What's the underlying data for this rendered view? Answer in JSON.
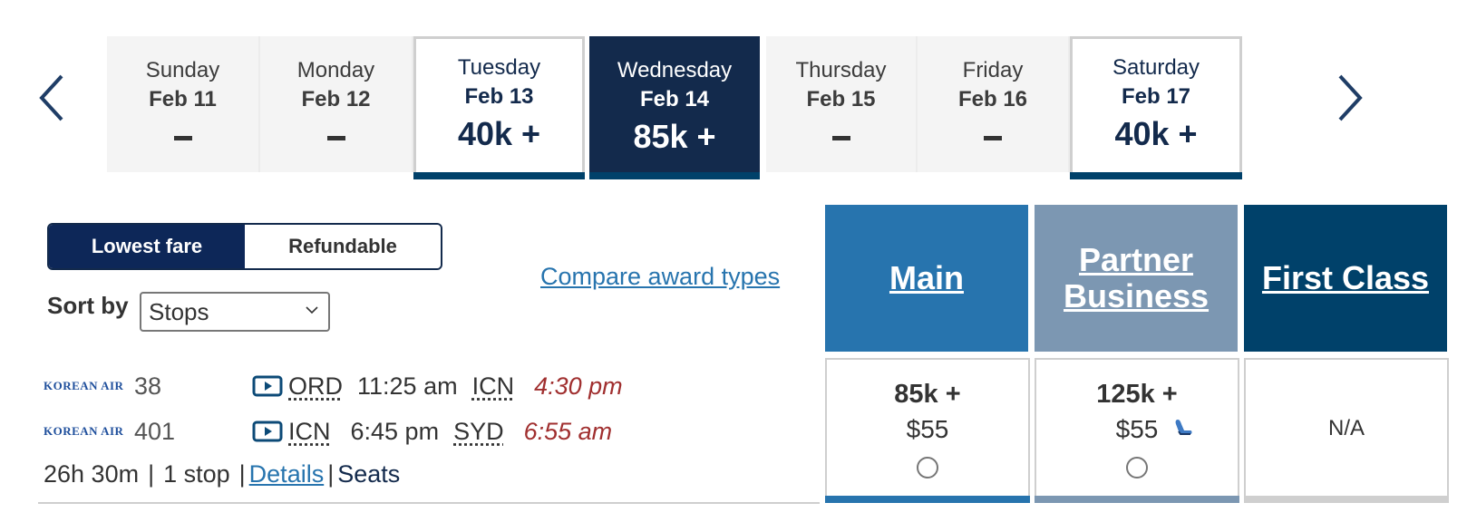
{
  "date_nav": {
    "prev_icon": "chevron-left-icon",
    "next_icon": "chevron-right-icon",
    "days": [
      {
        "dow": "Sunday",
        "date": "Feb 11",
        "price": "–",
        "state": "unavailable"
      },
      {
        "dow": "Monday",
        "date": "Feb 12",
        "price": "–",
        "state": "unavailable"
      },
      {
        "dow": "Tuesday",
        "date": "Feb 13",
        "price": "40k +",
        "state": "available"
      },
      {
        "dow": "Wednesday",
        "date": "Feb 14",
        "price": "85k +",
        "state": "selected"
      },
      {
        "dow": "Thursday",
        "date": "Feb 15",
        "price": "–",
        "state": "unavailable"
      },
      {
        "dow": "Friday",
        "date": "Feb 16",
        "price": "–",
        "state": "unavailable"
      },
      {
        "dow": "Saturday",
        "date": "Feb 17",
        "price": "40k +",
        "state": "available"
      }
    ]
  },
  "fare_toggle": {
    "options": [
      "Lowest fare",
      "Refundable"
    ],
    "active": "Lowest fare"
  },
  "sort": {
    "label": "Sort by",
    "selected": "Stops"
  },
  "compare_link": "Compare award types",
  "fare_columns": [
    {
      "title": "Main",
      "color": "#2774ae"
    },
    {
      "title": "Partner Business",
      "color": "#7c97b2"
    },
    {
      "title": "First Class",
      "color": "#00416a"
    }
  ],
  "flight": {
    "segments": [
      {
        "airline": "KOREAN AIR",
        "flight_no": "38",
        "depart_airport": "ORD",
        "depart_time": "11:25 am",
        "arrive_airport": "ICN",
        "arrive_time": "4:30 pm"
      },
      {
        "airline": "KOREAN AIR",
        "flight_no": "401",
        "depart_airport": "ICN",
        "depart_time": "6:45 pm",
        "arrive_airport": "SYD",
        "arrive_time": "6:55 am"
      }
    ],
    "duration": "26h 30m",
    "stops": "1 stop",
    "details_link": "Details",
    "seats_link": "Seats",
    "fares": {
      "main": {
        "miles": "85k +",
        "fee": "$55"
      },
      "partner_business": {
        "miles": "125k +",
        "fee": "$55",
        "icon": "lie-flat-seat-icon"
      },
      "first": {
        "text": "N/A"
      }
    }
  },
  "colors": {
    "navy": "#132a4c",
    "accent_bar": "#00416a",
    "link": "#2774ae",
    "arrival_time": "#a02f2f"
  }
}
